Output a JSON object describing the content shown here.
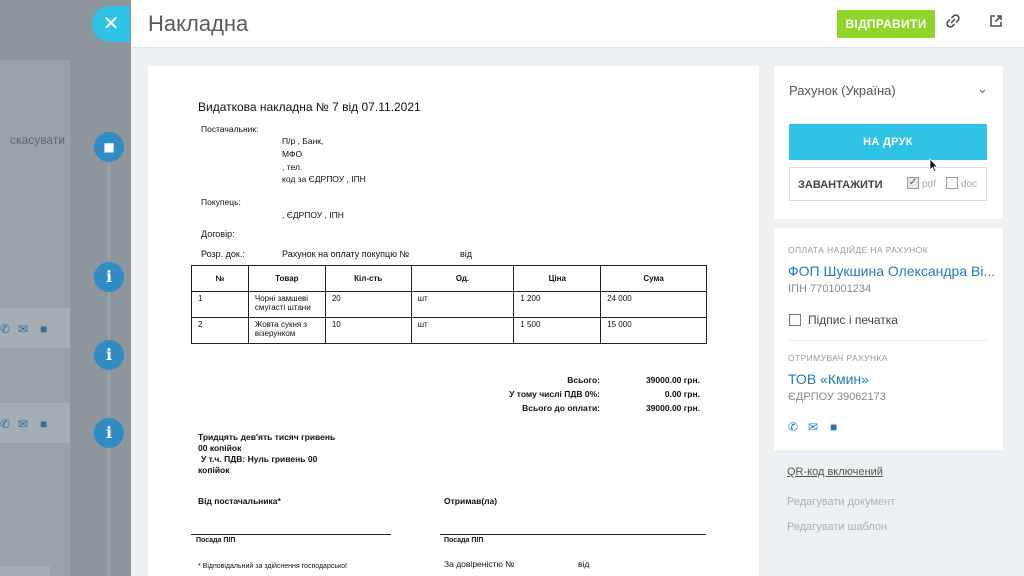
{
  "background": {
    "cancel_label": "скасувати"
  },
  "header": {
    "title": "Накладна",
    "send_label": "ВІДПРАВИТИ",
    "close_symbol": "✕"
  },
  "document": {
    "title": "Видаткова накладна № 7 від 07.11.2021",
    "supplier_label": "Постачальник:",
    "supplier_lines": [
      "П/р , Банк,",
      "МФО",
      ", тел.",
      "код за ЄДРПОУ , ІПН"
    ],
    "buyer_label": "Покупець:",
    "buyer_line": ", ЄДРПОУ , ІПН",
    "contract_label": "Договір:",
    "basis_label": "Розр. док.:",
    "basis_value": "Рахунок на оплату покупцю №",
    "basis_from": "від",
    "table": {
      "headers": [
        "№",
        "Товар",
        "Кіл-сть",
        "Од.",
        "Ціна",
        "Сума"
      ],
      "rows": [
        [
          "1",
          "Чорні замшеві смугасті штани",
          "20",
          "шт",
          "1 200",
          "24 000"
        ],
        [
          "2",
          "Жовта сукня з візерунком",
          "10",
          "шт",
          "1 500",
          "15 000"
        ]
      ]
    },
    "totals": {
      "total_label": "Всього:",
      "total_value": "39000.00 грн.",
      "vat_label": "У тому числі ПДВ 0%:",
      "vat_value": "0.00 грн.",
      "due_label": "Всього до оплати:",
      "due_value": "39000.00 грн."
    },
    "amount_words_1": "Тридцять дев'ять тисяч гривень",
    "amount_words_2": "00 копійок",
    "vat_words_1": "У т.ч. ПДВ: Нуль гривень 00",
    "vat_words_2": "копійок",
    "from_supplier": "Від постачальника*",
    "received": "Отримав(ла)",
    "position_left": "Посада ПІП",
    "position_right": "Посада ПІП",
    "footnote": "* Відповідальний за здійснення господарської",
    "proxy": "За довіреністю №",
    "proxy_from": "від"
  },
  "sidebar": {
    "template_select": "Рахунок (Україна)",
    "print_label": "НА ДРУК",
    "download_label": "ЗАВАНТАЖИТИ",
    "pdf_label": "pdf",
    "doc_label": "doc",
    "pdf_checked": true,
    "doc_checked": false,
    "payment_caption": "ОПЛАТА НАДІЙДЕ НА РАХУНОК",
    "payee_name": "ФОП Шукшина Олександра Ві...",
    "payee_ipn": "ІПН 7701001234",
    "signature_label": "Підпис і печатка",
    "recipient_caption": "ОТРИМУВАЧ РАХУНКА",
    "recipient_name": "ТОВ «Кмин»",
    "recipient_code": "ЄДРПОУ 39062173",
    "qr_label": "QR-код включений",
    "edit_doc": "Редагувати документ",
    "edit_template": "Редагувати шаблон"
  },
  "colors": {
    "accent": "#2ec3e5",
    "send": "#8ed62a",
    "link": "#2779b6"
  }
}
